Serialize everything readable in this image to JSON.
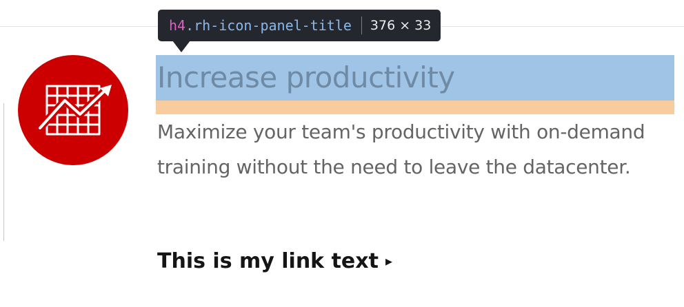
{
  "tooltip": {
    "tag": "h4",
    "class_name": ".rh-icon-panel-title",
    "dimensions": "376 × 33"
  },
  "panel": {
    "title": "Increase productivity",
    "body": "Maximize your team's productivity with on-demand training without the need to leave the datacenter.",
    "link_text": "This is my link text",
    "link_caret": "▸",
    "icon": "productivity-chart-icon"
  },
  "colors": {
    "brand_red": "#cc0000",
    "text_gray": "#646464",
    "link_text": "#151515",
    "tooltip_bg": "#24282e",
    "tooltip_tag": "#e45ec6",
    "tooltip_class": "#8ab8ea",
    "tooltip_dims": "#ececec",
    "highlight_content": "#9fc4e6",
    "highlight_margin": "#f8cc9c",
    "title_on_highlight": "#6e8aa5"
  }
}
